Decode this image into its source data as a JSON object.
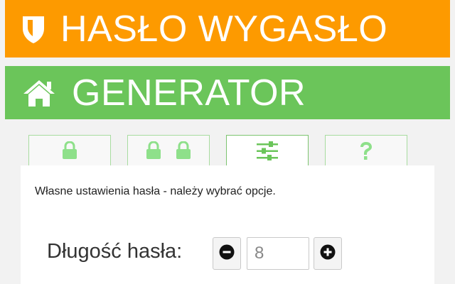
{
  "colors": {
    "orange_banner": "#fd9a00",
    "green_banner": "#6bc55a",
    "tab_icon": "#8ee08a",
    "tab_border": "#a8dca0"
  },
  "header": {
    "title": "HASŁO WYGASŁO",
    "icon": "shield-icon"
  },
  "section": {
    "title": "GENERATOR",
    "icon": "home-icon"
  },
  "tabs": [
    {
      "icon": "lock-icon",
      "active": false
    },
    {
      "icon": "double-lock-icon",
      "active": false
    },
    {
      "icon": "sliders-icon",
      "active": true
    },
    {
      "icon": "question-icon",
      "active": false
    }
  ],
  "panel": {
    "description": "Własne ustawienia hasła - należy wybrać opcje.",
    "length": {
      "label": "Długość hasła:",
      "value": "8"
    }
  }
}
